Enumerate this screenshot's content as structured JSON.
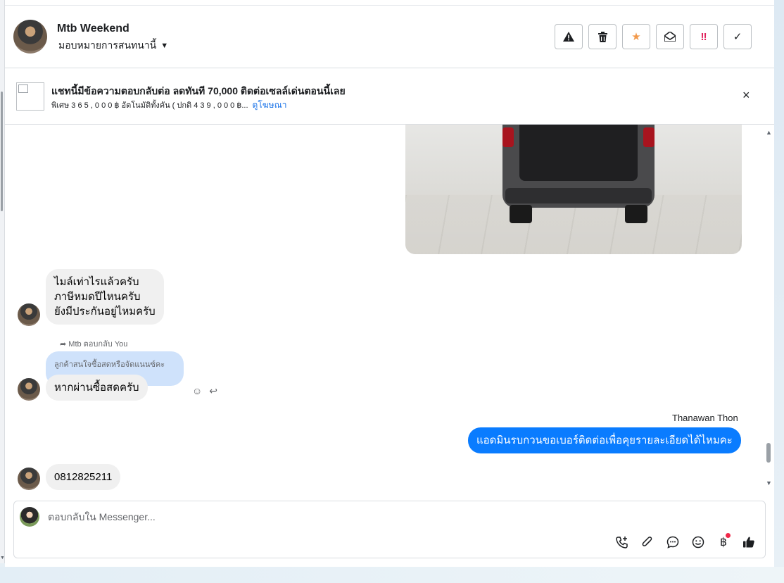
{
  "header": {
    "contact_name": "Mtb Weekend",
    "assign_label": "มอบหมายการสนทนานี้",
    "toolbar": {
      "spam_icon": "warning-icon",
      "delete_icon": "trash-icon",
      "star_icon": "star-icon",
      "unread_icon": "open-envelope-icon",
      "priority_icon": "exclamation-icon",
      "done_icon": "check-icon"
    }
  },
  "ad_banner": {
    "title": "แชทนี้มีข้อความตอบกลับต่อ ลดทันที 70,000 ติดต่อเซลล์เด่นตอนนี้เลย",
    "subtitle": "พิเศษ 🔢🔢🔢,🔢🔢🔢 ฿ อัตโนมัติทั้งคัน ( ปกติ 🔢🔢🔢,🔢🔢🔢 ฿...",
    "subtitle_display": "พิเศษ 3 6 5 , 0 0 0 ฿ อัตโนมัติทั้งคัน ( ปกติ 4 3 9 , 0 0 0 ฿...",
    "link": "ดูโฆษณา",
    "close": "×"
  },
  "messages": {
    "m1": {
      "lines": "ไมล์เท่าไรแล้วครับ\nภาษีหมดปีไหนครับ\nยังมีประกันอยู่ไหมครับ"
    },
    "reply_meta": "Mtb ตอบกลับ You",
    "quoted": "ลูกค้าสนใจซื้อสดหรือจัดแนนซ์คะ",
    "m2": "หากผ่านซื้อสดครับ",
    "out_sender": "Thanawan Thon",
    "out_msg": "แอดมินรบกวนขอเบอร์ติดต่อเพื่อคุยรายละเอียดได้ไหมคะ",
    "m3": "0812825211"
  },
  "composer": {
    "placeholder": "ตอบกลับใน Messenger..."
  }
}
